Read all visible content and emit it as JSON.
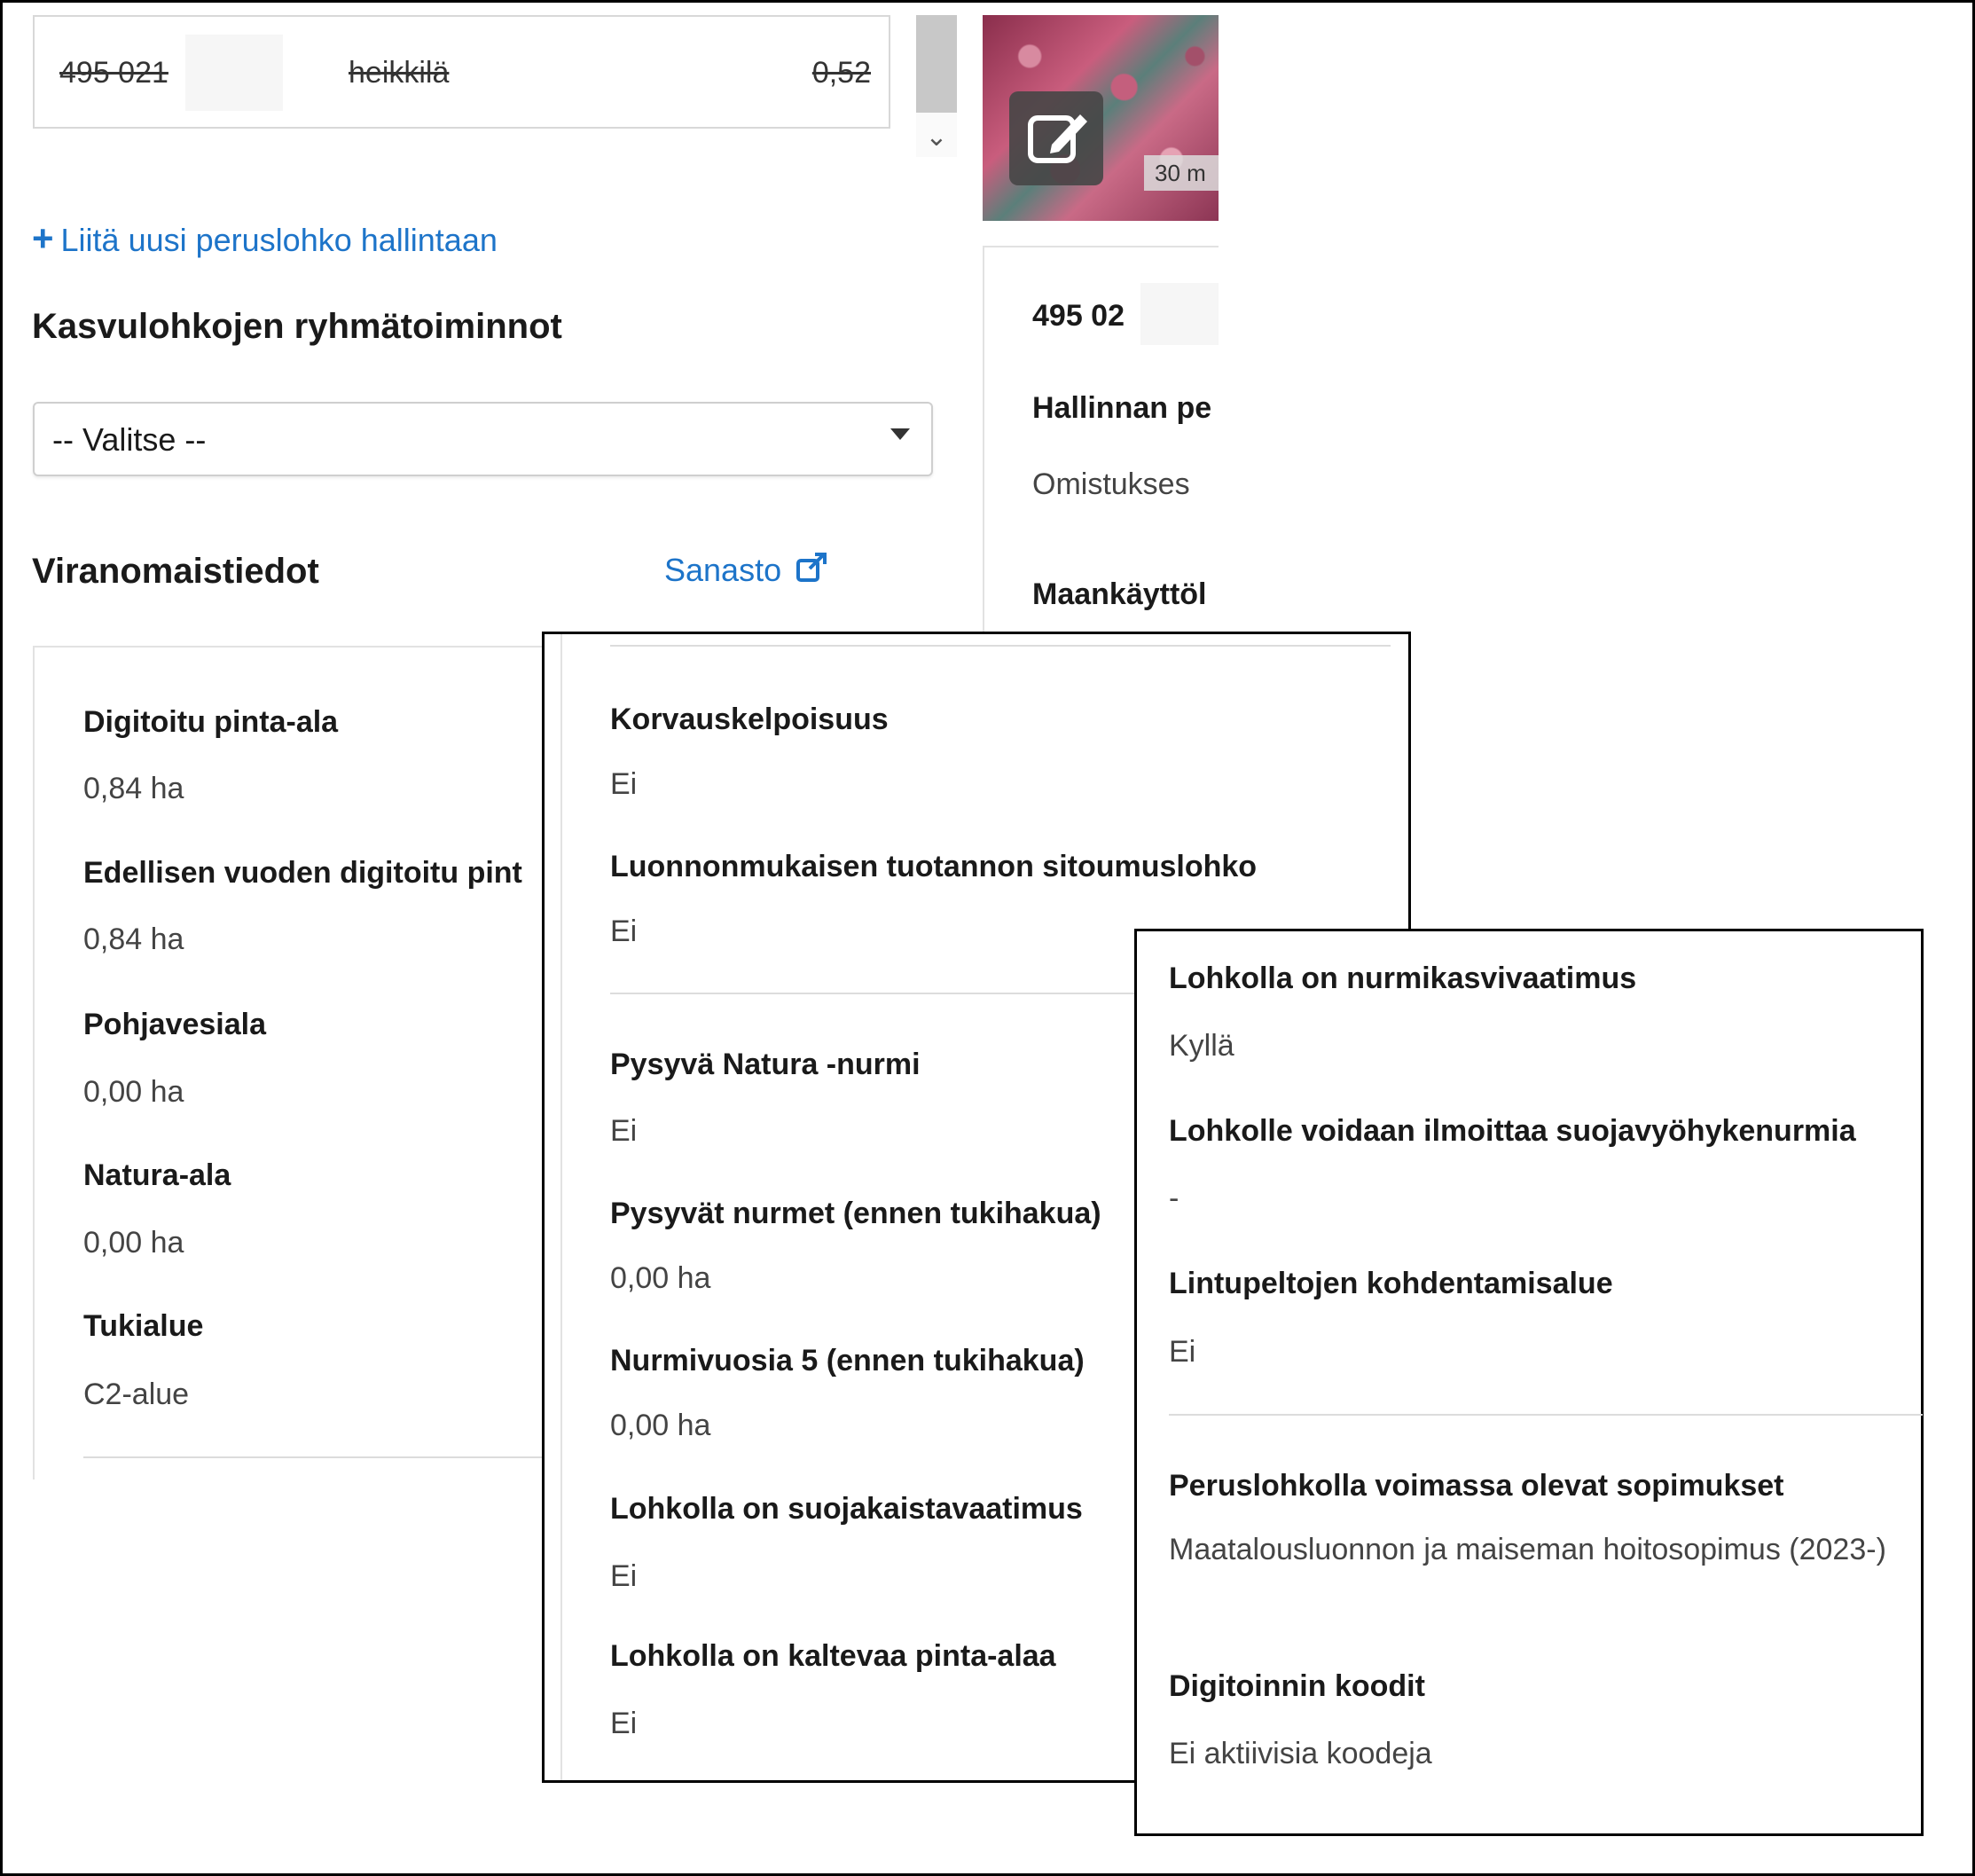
{
  "parcel_row": {
    "id": "495 021",
    "name": "heikkilä",
    "area": "0,52"
  },
  "map": {
    "scale": "30 m"
  },
  "add_link": {
    "plus": "+",
    "label": "Liitä uusi peruslohko hallintaan"
  },
  "group_actions": {
    "title": "Kasvulohkojen ryhmätoiminnot",
    "select_value": "-- Valitse --"
  },
  "authority": {
    "title": "Viranomaistiedot",
    "glossary": "Sanasto"
  },
  "left_card": {
    "items": [
      {
        "label": "Digitoitu pinta-ala",
        "value": "0,84 ha"
      },
      {
        "label": "Edellisen vuoden digitoitu pint",
        "value": "0,84 ha"
      },
      {
        "label": "Pohjavesiala",
        "value": "0,00 ha"
      },
      {
        "label": "Natura-ala",
        "value": "0,00 ha"
      },
      {
        "label": "Tukialue",
        "value": "C2-alue"
      }
    ]
  },
  "right_card": {
    "id": "495 02",
    "label1": "Hallinnan pe",
    "value1": "Omistukses",
    "label2": "Maankäyttöl"
  },
  "panel1": {
    "items": [
      {
        "label": "Korvauskelpoisuus",
        "value": "Ei"
      },
      {
        "label": "Luonnonmukaisen tuotannon sitoumuslohko",
        "value": "Ei"
      },
      {
        "label": "Pysyvä Natura -nurmi",
        "value": "Ei"
      },
      {
        "label": "Pysyvät nurmet (ennen tukihakua)",
        "value": "0,00 ha"
      },
      {
        "label": "Nurmivuosia 5 (ennen tukihakua)",
        "value": "0,00 ha"
      },
      {
        "label": "Lohkolla on suojakaistavaatimus",
        "value": "Ei"
      },
      {
        "label": "Lohkolla on kaltevaa pinta-alaa",
        "value": "Ei"
      }
    ]
  },
  "panel2": {
    "items": [
      {
        "label": "Lohkolla on nurmikasvivaatimus",
        "value": "Kyllä"
      },
      {
        "label": "Lohkolle voidaan ilmoittaa suojavyöhykenurmia",
        "value": "-"
      },
      {
        "label": "Lintupeltojen kohdentamisalue",
        "value": "Ei"
      },
      {
        "label": "Peruslohkolla voimassa olevat sopimukset",
        "value": "Maatalousluonnon ja maiseman hoitosopimus (2023-)"
      },
      {
        "label": "Digitoinnin koodit",
        "value": "Ei aktiivisia koodeja"
      }
    ]
  }
}
